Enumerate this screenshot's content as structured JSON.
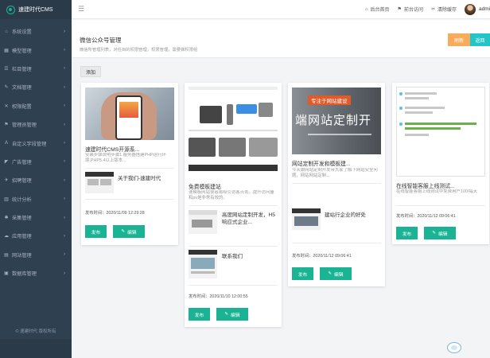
{
  "app": {
    "brand": "速建时代CMS"
  },
  "sidebar": {
    "items": [
      {
        "icon": "⌂",
        "label": "系统设置"
      },
      {
        "icon": "▦",
        "label": "模型管理"
      },
      {
        "icon": "☰",
        "label": "栏目管理"
      },
      {
        "icon": "✎",
        "label": "文档管理"
      },
      {
        "icon": "✕",
        "label": "权限配置"
      },
      {
        "icon": "⚑",
        "label": "管理员管理"
      },
      {
        "icon": "A",
        "label": "自定义字段管理"
      },
      {
        "icon": "◤",
        "label": "广告管理"
      },
      {
        "icon": "✈",
        "label": "招聘管理"
      },
      {
        "icon": "▥",
        "label": "统计分析"
      },
      {
        "icon": "✱",
        "label": "采集管理"
      },
      {
        "icon": "☁",
        "label": "应用管理"
      },
      {
        "icon": "▤",
        "label": "网站管理"
      },
      {
        "icon": "▣",
        "label": "数据库管理"
      }
    ],
    "footer": "© 速建时代 版权所有"
  },
  "topbar": {
    "links": [
      {
        "icon": "⌂",
        "label": "后台首页"
      },
      {
        "icon": "⚑",
        "label": "前台访问"
      },
      {
        "icon": "✂",
        "label": "清除缓存"
      }
    ],
    "username": "admin"
  },
  "page": {
    "title": "微信公众号管理",
    "subtitle": "微信所管理列表，对任目的权限管理，权限管理，需要做权限组",
    "refresh_label": "刷新",
    "back_label": "返回",
    "add_label": "添加"
  },
  "cards": [
    {
      "title": "速建时代CMS开源系...",
      "desc": "安装步骤说明步骤1.服务器搭建PHP运行环境,PHP5.4以上版本...",
      "sub_items": [
        {
          "title": "关于我们-速建时代"
        }
      ],
      "time": "发布时间：2020/11/09 12:29:28",
      "publish_label": "发布",
      "edit_label": "编辑"
    },
    {
      "title": "免费模板建站",
      "desc": "速模板网站很容易吸引访客点击。提升访问量和pv是非常有效的。",
      "sub_items": [
        {
          "title": "高度网站定制开发，H5响应式企业..."
        },
        {
          "title": "联系我们"
        }
      ],
      "time": "发布时间：2020/11/10 12:00:55",
      "publish_label": "发布",
      "edit_label": "编辑"
    },
    {
      "title": "网站定制开发和模板建...",
      "desc": "今天跟网站定制开发带大家了解下网站安全问题，网站网站定制...",
      "banner_tag": "专注于网站建设",
      "banner_text": "端网站定制开",
      "sub_items": [
        {
          "title": "建站行企业的好处"
        }
      ],
      "time": "发布时间：2020/11/12 09:06:41",
      "publish_label": "发布",
      "edit_label": "编辑"
    },
    {
      "title": "在线智能客服上线测试...",
      "desc": "在线智能客服上线测试中免费用户100/每天",
      "sub_items": [],
      "time": "发布时间：2020/11/12 09:06:41",
      "publish_label": "发布",
      "edit_label": "编辑"
    }
  ]
}
